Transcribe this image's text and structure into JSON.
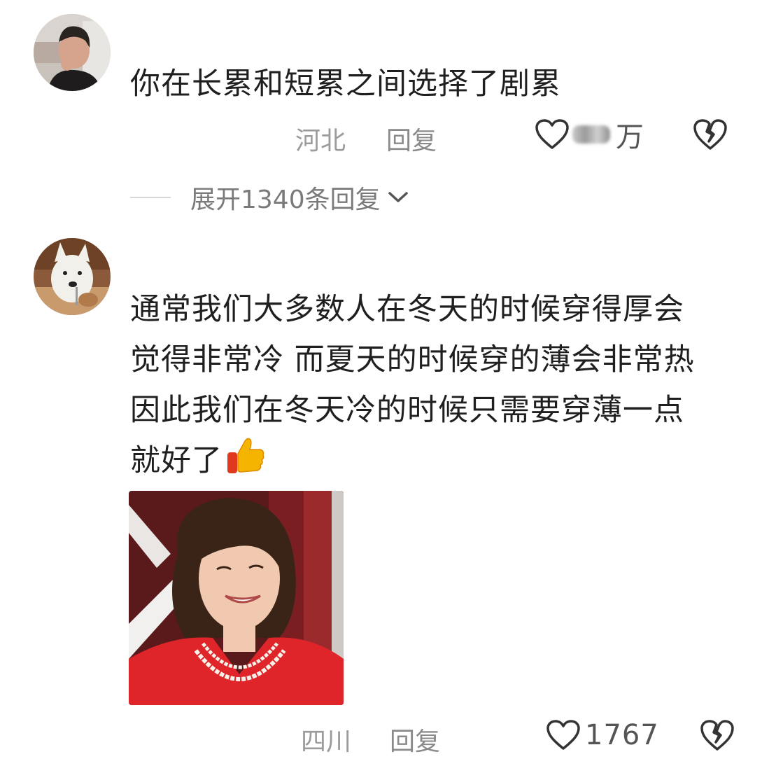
{
  "comments": [
    {
      "text_lines": [
        "你在长累和短累之间选择了剧累"
      ],
      "location": "河北",
      "reply_label": "回复",
      "like_count_suffix": "万",
      "like_count_obscured": true,
      "expand_label": "展开1340条回复"
    },
    {
      "text_lines": [
        "通常我们大多数人在冬天的时候穿得厚会",
        "觉得非常冷 而夏天的时候穿的薄会非常热",
        "因此我们在冬天冷的时候只需要穿薄一点",
        "就好了"
      ],
      "emoji": "thumbs-up",
      "location": "四川",
      "reply_label": "回复",
      "like_count": "1767"
    }
  ],
  "icons": {
    "like": "heart-outline-icon",
    "dislike": "broken-heart-icon",
    "expand": "chevron-down-icon"
  },
  "colors": {
    "text": "#1f1f1f",
    "meta": "#9b9b9b",
    "expand": "#7a7a7a",
    "thumb": "#f5b400"
  }
}
